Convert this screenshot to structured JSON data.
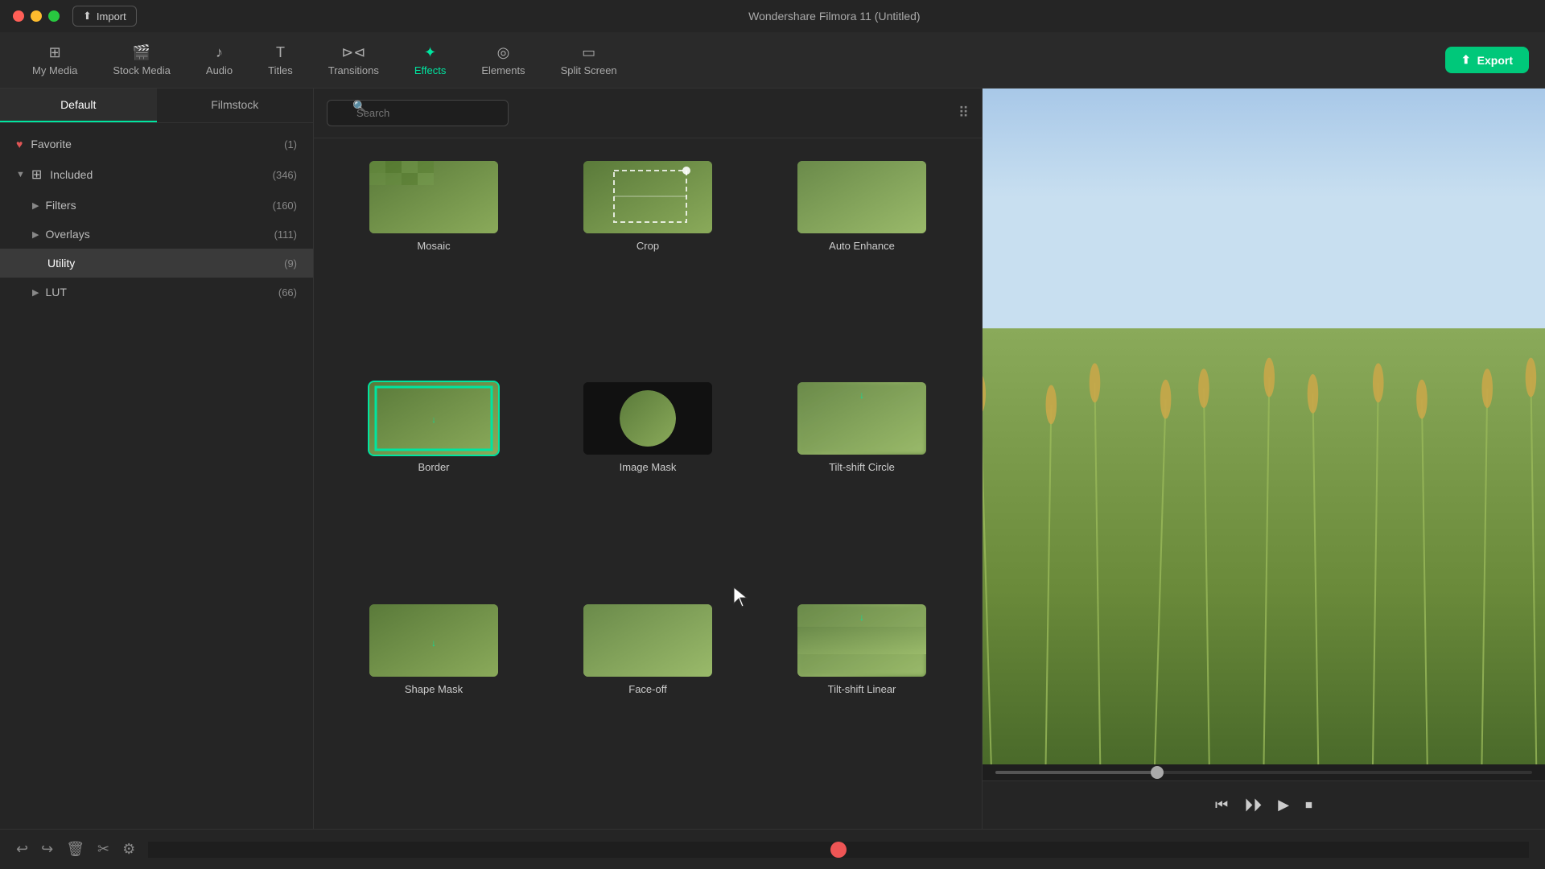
{
  "window": {
    "title": "Wondershare Filmora 11 (Untitled)"
  },
  "titlebar": {
    "import_label": "Import"
  },
  "nav": {
    "items": [
      {
        "id": "my-media",
        "label": "My Media",
        "icon": "⊞"
      },
      {
        "id": "stock-media",
        "label": "Stock Media",
        "icon": "🎬"
      },
      {
        "id": "audio",
        "label": "Audio",
        "icon": "♪"
      },
      {
        "id": "titles",
        "label": "Titles",
        "icon": "T"
      },
      {
        "id": "transitions",
        "label": "Transitions",
        "icon": "⊳⊲"
      },
      {
        "id": "effects",
        "label": "Effects",
        "icon": "✦",
        "active": true
      },
      {
        "id": "elements",
        "label": "Elements",
        "icon": "◎"
      },
      {
        "id": "split-screen",
        "label": "Split Screen",
        "icon": "▭"
      }
    ],
    "export_label": "Export"
  },
  "sidebar": {
    "tab_default": "Default",
    "tab_filmstock": "Filmstock",
    "items": [
      {
        "id": "favorite",
        "label": "Favorite",
        "count": "(1)",
        "icon": "♥",
        "indent": false,
        "chevron": ""
      },
      {
        "id": "included",
        "label": "Included",
        "count": "(346)",
        "icon": "⊞",
        "indent": false,
        "chevron": "▼",
        "expanded": true
      },
      {
        "id": "filters",
        "label": "Filters",
        "count": "(160)",
        "indent": true,
        "chevron": "▶"
      },
      {
        "id": "overlays",
        "label": "Overlays",
        "count": "(111)",
        "indent": true,
        "chevron": "▶"
      },
      {
        "id": "utility",
        "label": "Utility",
        "count": "(9)",
        "indent": true,
        "active": true
      },
      {
        "id": "lut",
        "label": "LUT",
        "count": "(66)",
        "indent": true,
        "chevron": "▶"
      }
    ]
  },
  "effects_panel": {
    "search_placeholder": "Search",
    "effects": [
      {
        "id": "mosaic",
        "name": "Mosaic",
        "thumb_type": "mosaic",
        "has_download": false,
        "selected": false
      },
      {
        "id": "crop",
        "name": "Crop",
        "thumb_type": "crop",
        "has_download": false,
        "selected": false
      },
      {
        "id": "auto-enhance",
        "name": "Auto Enhance",
        "thumb_type": "auto-enhance",
        "has_download": false,
        "selected": false
      },
      {
        "id": "border",
        "name": "Border",
        "thumb_type": "border",
        "has_download": false,
        "selected": true
      },
      {
        "id": "image-mask",
        "name": "Image Mask",
        "thumb_type": "image-mask",
        "has_download": false,
        "selected": false
      },
      {
        "id": "tiltshift-circle",
        "name": "Tilt-shift Circle",
        "thumb_type": "tiltshift-circle",
        "has_download": true,
        "selected": false
      },
      {
        "id": "shape-mask",
        "name": "Shape Mask",
        "thumb_type": "shape-mask",
        "has_download": false,
        "selected": false
      },
      {
        "id": "faceoff",
        "name": "Face-off",
        "thumb_type": "faceoff",
        "has_download": false,
        "selected": false
      },
      {
        "id": "tiltshift-linear",
        "name": "Tilt-shift Linear",
        "thumb_type": "tiltshift-linear",
        "has_download": true,
        "selected": false
      }
    ]
  },
  "toolbar": {
    "undo": "↩",
    "redo": "↪",
    "delete": "🗑",
    "cut": "✂",
    "settings": "⚙"
  },
  "playback": {
    "step_back": "⏮",
    "play_pause": "⏵⏵",
    "play": "▶",
    "stop": "⏹"
  }
}
